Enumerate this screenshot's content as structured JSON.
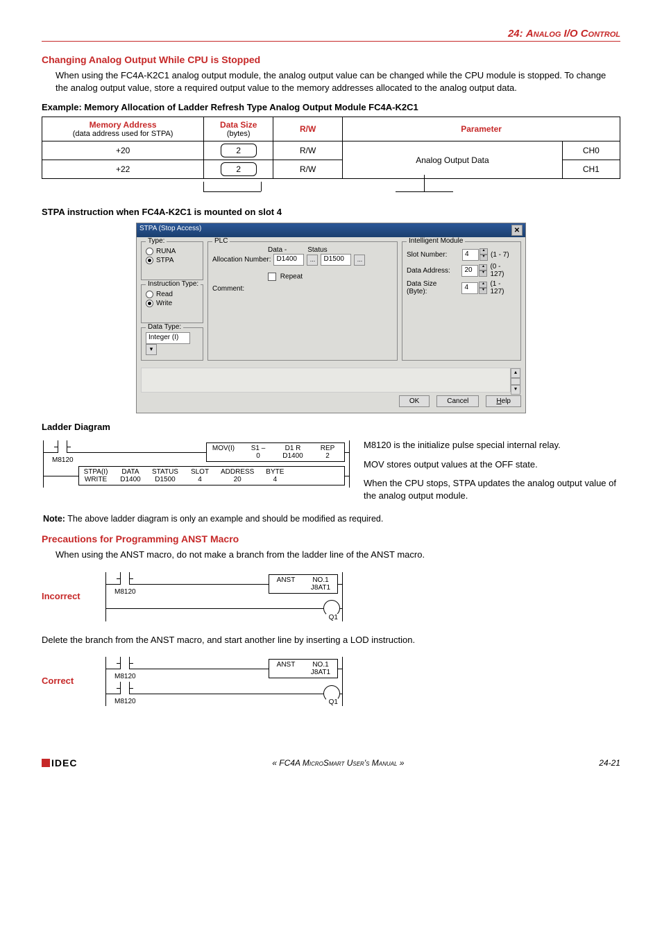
{
  "header": {
    "chapter": "24:",
    "title": "Analog I/O Control"
  },
  "sec1": {
    "heading": "Changing Analog Output While CPU is Stopped",
    "para": "When using the FC4A-K2C1 analog output module, the analog output value can be changed while the CPU module is stopped. To change the analog output value, store a required output value to the memory addresses allocated to the analog output data."
  },
  "example_heading": "Example: Memory Allocation of Ladder Refresh Type Analog Output Module FC4A-K2C1",
  "memtable": {
    "headers": {
      "c1a": "Memory Address",
      "c1b": "(data address used for STPA)",
      "c2a": "Data Size",
      "c2b": "(bytes)",
      "c3": "R/W",
      "c4": "Parameter"
    },
    "rows": [
      {
        "addr": "+20",
        "size": "2",
        "rw": "R/W",
        "param": "Analog Output Data",
        "ch": "CH0"
      },
      {
        "addr": "+22",
        "size": "2",
        "rw": "R/W",
        "param": "",
        "ch": "CH1"
      }
    ]
  },
  "stpa_heading": "STPA instruction when FC4A-K2C1 is mounted on slot 4",
  "dialog": {
    "title": "STPA (Stop Access)",
    "type_group": "Type:",
    "type_runa": "RUNA",
    "type_stpa": "STPA",
    "itype_group": "Instruction Type:",
    "itype_read": "Read",
    "itype_write": "Write",
    "dtype_group": "Data Type:",
    "dtype_val": "Integer (I)",
    "plc_group": "PLC",
    "alloc_lbl": "Allocation Number:",
    "alloc_val": "D1400",
    "data_lbl": "Data -",
    "status_lbl": "Status",
    "status_val": "D1500",
    "repeat_lbl": "Repeat",
    "comment_lbl": "Comment:",
    "im_group": "Intelligent Module",
    "slot_lbl": "Slot Number:",
    "slot_val": "4",
    "slot_range": "(1 - 7)",
    "daddr_lbl": "Data Address:",
    "daddr_val": "20",
    "daddr_range": "(0 - 127)",
    "dsize_lbl": "Data Size (Byte):",
    "dsize_val": "4",
    "dsize_range": "(1 - 127)",
    "ok": "OK",
    "cancel": "Cancel",
    "help": "Help"
  },
  "ladder_heading": "Ladder Diagram",
  "ladder1": {
    "contact": "M8120",
    "mov": {
      "op": "MOV(I)",
      "s1top": "S1 –",
      "s1bot": "0",
      "d1top": "D1 R",
      "d1bot": "D1400",
      "reptop": "REP",
      "repbot": "2"
    },
    "stpa": {
      "op": "STPA(I)",
      "op2": "WRITE",
      "data1": "DATA",
      "data2": "D1400",
      "status1": "STATUS",
      "status2": "D1500",
      "slot1": "SLOT",
      "slot2": "4",
      "addr1": "ADDRESS",
      "addr2": "20",
      "byte1": "BYTE",
      "byte2": "4"
    }
  },
  "ladder_side": {
    "p1": "M8120 is the initialize pulse special internal relay.",
    "p2": "MOV stores output values at the OFF state.",
    "p3": "When the CPU stops, STPA updates the analog output value of the analog output module."
  },
  "note_label": "Note:",
  "note_text": "The above ladder diagram is only an example and should be modified as required.",
  "prec_heading": "Precautions for Programming ANST Macro",
  "prec_para": "When using the ANST macro, do not make a branch from the ladder line of the ANST macro.",
  "incorrect_label": "Incorrect",
  "anst": {
    "op": "ANST",
    "n1": "NO.1",
    "n2": "J8AT1"
  },
  "q1": "Q1",
  "delete_para": "Delete the branch from the ANST macro, and start another line by inserting a LOD instruction.",
  "correct_label": "Correct",
  "m8120b": "M8120",
  "footer": {
    "logo": "IDEC",
    "center_pre": "« FC4A M",
    "center_mid": "icroSmart User's Manual",
    "center_post": " »",
    "page": "24-21"
  }
}
